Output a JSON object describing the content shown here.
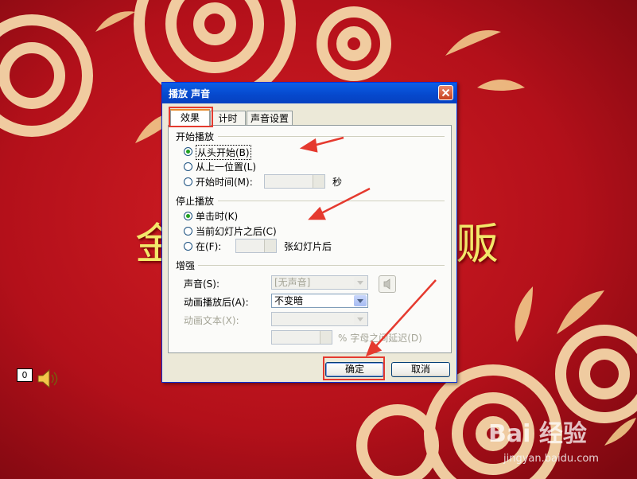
{
  "slide": {
    "title_left": "金",
    "title_right": "贩",
    "counter": "0",
    "watermark": "Bai 经验",
    "watermark_site": "jingyan.baidu.com"
  },
  "dialog": {
    "title": "播放 声音",
    "tabs": [
      {
        "label": "效果",
        "active": true
      },
      {
        "label": "计时",
        "active": false
      },
      {
        "label": "声音设置",
        "active": false
      }
    ],
    "start_group": {
      "label": "开始播放",
      "options": [
        {
          "label": "从头开始(B)",
          "checked": true
        },
        {
          "label": "从上一位置(L)",
          "checked": false
        },
        {
          "label": "开始时间(M):",
          "checked": false
        }
      ],
      "time_unit": "秒"
    },
    "stop_group": {
      "label": "停止播放",
      "options": [
        {
          "label": "单击时(K)",
          "checked": true
        },
        {
          "label": "当前幻灯片之后(C)",
          "checked": false
        },
        {
          "label": "在(F):",
          "checked": false
        }
      ],
      "after_slides": "张幻灯片后"
    },
    "enhance_group": {
      "label": "增强",
      "sound_label": "声音(S):",
      "sound_value": "[无声音]",
      "after_anim_label": "动画播放后(A):",
      "after_anim_value": "不变暗",
      "anim_text_label": "动画文本(X):",
      "delay_label": "% 字母之间延迟(D)"
    },
    "ok_label": "确定",
    "cancel_label": "取消"
  },
  "colors": {
    "background": "#b8131c",
    "accent_red": "#e53a2f",
    "title_blue": "#0648cc",
    "slide_title": "#f3e86a"
  }
}
